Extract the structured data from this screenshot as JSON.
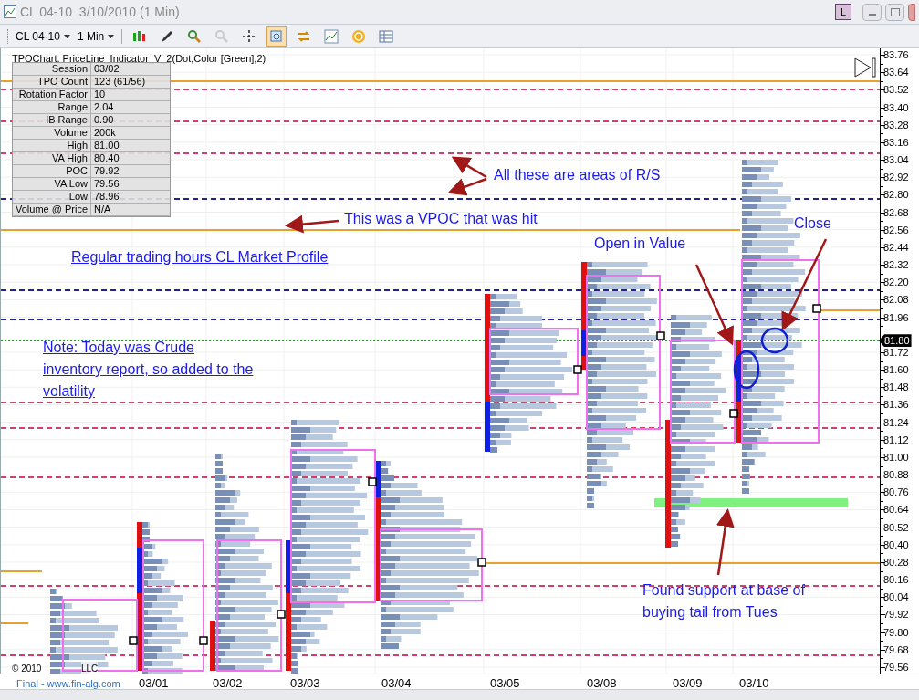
{
  "window": {
    "title": "CL 04-10  3/10/2010 (1 Min)",
    "layout_button": "L"
  },
  "toolbar": {
    "symbol": "CL 04-10",
    "interval": "1 Min",
    "tools": [
      {
        "kind": "candles",
        "selected": false,
        "disabled": false
      },
      {
        "kind": "pen",
        "selected": false,
        "disabled": false
      },
      {
        "kind": "zoom_in",
        "selected": false,
        "disabled": false
      },
      {
        "kind": "zoom_out",
        "selected": false,
        "disabled": true
      },
      {
        "kind": "crosshair",
        "selected": false,
        "disabled": false
      },
      {
        "kind": "zoom_box",
        "selected": true,
        "disabled": false
      },
      {
        "kind": "transfer",
        "selected": false,
        "disabled": false
      },
      {
        "kind": "chart",
        "selected": false,
        "disabled": false
      },
      {
        "kind": "coin",
        "selected": false,
        "disabled": false
      },
      {
        "kind": "table",
        "selected": false,
        "disabled": false
      }
    ]
  },
  "chart": {
    "header": "TPOChart, PriceLine_Indicator_V_2(Dot,Color [Green],2)",
    "info_table": [
      {
        "label": "Session",
        "value": "03/02"
      },
      {
        "label": "TPO Count",
        "value": "123 (61/56)"
      },
      {
        "label": "Rotation Factor",
        "value": "10"
      },
      {
        "label": "Range",
        "value": "2.04"
      },
      {
        "label": "IB Range",
        "value": "0.90"
      },
      {
        "label": "Volume",
        "value": "200k"
      },
      {
        "label": "High",
        "value": "81.00"
      },
      {
        "label": "VA High",
        "value": "80.40"
      },
      {
        "label": "POC",
        "value": "79.92"
      },
      {
        "label": "VA Low",
        "value": "79.56"
      },
      {
        "label": "Low",
        "value": "78.96"
      },
      {
        "label": "Volume @ Price",
        "value": "N/A"
      }
    ],
    "price_axis": [
      "83.76",
      "83.64",
      "83.52",
      "83.40",
      "83.28",
      "83.16",
      "83.04",
      "82.92",
      "82.80",
      "82.68",
      "82.56",
      "82.44",
      "82.32",
      "82.20",
      "82.08",
      "81.96",
      "81.72",
      "81.60",
      "81.48",
      "81.36",
      "81.24",
      "81.12",
      "81.00",
      "80.88",
      "80.76",
      "80.64",
      "80.52",
      "80.40",
      "80.28",
      "80.16",
      "80.04",
      "79.92",
      "79.80",
      "79.68",
      "79.56"
    ],
    "current_price": "81.80",
    "dates": [
      "03/01",
      "03/02",
      "03/03",
      "03/04",
      "03/05",
      "03/08",
      "03/09",
      "03/10"
    ],
    "annotations": [
      {
        "kind": "plain",
        "lines": [
          "All these are areas of R/S"
        ]
      },
      {
        "kind": "plain",
        "lines": [
          "This was a VPOC that was hit"
        ]
      },
      {
        "kind": "underlined",
        "lines": [
          "Regular trading hours CL Market Profile"
        ]
      },
      {
        "kind": "underlined",
        "lines": [
          "Note: Today was Crude",
          "inventory report, so added to the",
          "volatility"
        ]
      },
      {
        "kind": "plain",
        "lines": [
          "Open in Value"
        ]
      },
      {
        "kind": "plain",
        "lines": [
          "Close"
        ]
      },
      {
        "kind": "plain",
        "lines": [
          "Found support at base of",
          "buying tail from Tues"
        ]
      }
    ],
    "copyright": "© 2010",
    "copyright_suffix": "LLC"
  },
  "footer": "Final - www.fin-alg.com"
}
